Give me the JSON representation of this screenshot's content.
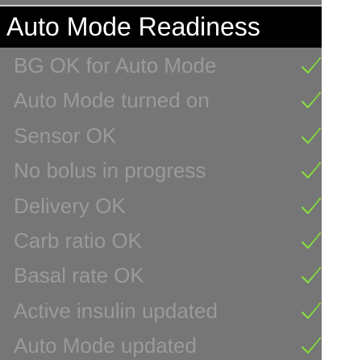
{
  "header": {
    "title": "Auto Mode Readiness"
  },
  "colors": {
    "background": "#767676",
    "header_bg": "#000000",
    "header_text": "#ffffff",
    "item_text": "#9a9a9a",
    "check": "#8ee04a"
  },
  "items": [
    {
      "label": "BG OK for Auto Mode",
      "status_icon": "check-icon"
    },
    {
      "label": "Auto Mode turned on",
      "status_icon": "check-icon"
    },
    {
      "label": "Sensor OK",
      "status_icon": "check-icon"
    },
    {
      "label": "No bolus in progress",
      "status_icon": "check-icon"
    },
    {
      "label": "Delivery OK",
      "status_icon": "check-icon"
    },
    {
      "label": "Carb ratio OK",
      "status_icon": "check-icon"
    },
    {
      "label": "Basal rate OK",
      "status_icon": "check-icon"
    },
    {
      "label": "Active insulin updated",
      "status_icon": "check-icon"
    },
    {
      "label": "Auto Mode updated",
      "status_icon": "check-icon"
    }
  ]
}
